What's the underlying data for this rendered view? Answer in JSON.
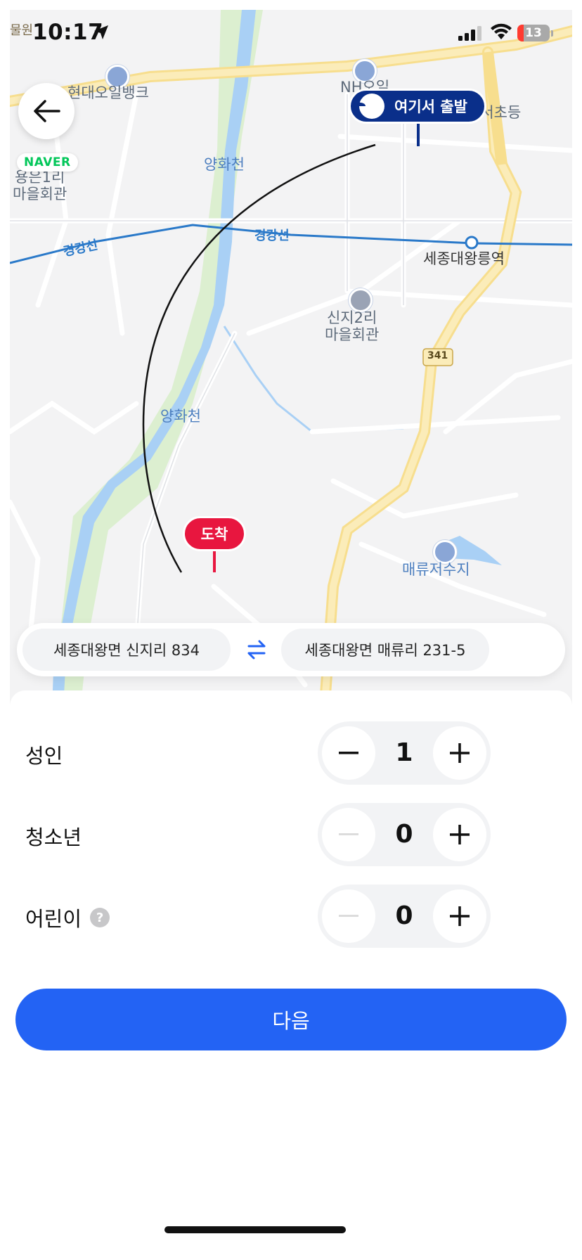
{
  "status_bar": {
    "time": "10:17",
    "battery": "13"
  },
  "map": {
    "provider_logo": "NAVER",
    "start_marker_label": "여기서 출발",
    "arrival_marker_label": "도착",
    "labels": {
      "gas_station": "현대오일뱅크",
      "nh_oil": "NH오일",
      "school": "능서초등",
      "village_hall_1": "용은1리\n마을회관",
      "river_1": "양화천",
      "river_2": "양화천",
      "rail_1": "경강선",
      "rail_2": "경강선",
      "station": "세종대왕릉역",
      "village_hall_2": "신지2리\n마을회관",
      "route_number": "341",
      "reservoir": "매류저수지",
      "corner": "물원"
    }
  },
  "route": {
    "from": "세종대왕면 신지리 834",
    "to": "세종대왕면 매류리 231-5"
  },
  "passengers": [
    {
      "label": "성인",
      "count": "1",
      "minus_enabled": true
    },
    {
      "label": "청소년",
      "count": "0",
      "minus_enabled": false
    },
    {
      "label": "어린이",
      "count": "0",
      "minus_enabled": false
    }
  ],
  "help_icon_glyph": "?",
  "next_button_label": "다음",
  "colors": {
    "primary": "#2363f4",
    "start_marker": "#0a2f8a",
    "arrival_marker": "#e8163f",
    "naver_green": "#03c75a",
    "river": "#a9d0f5",
    "park": "#dcefd0",
    "road_major": "#f7de8e"
  },
  "icons": {
    "back": "arrow-left-icon",
    "swap": "swap-arrows-icon",
    "minus": "minus-icon",
    "plus": "plus-icon",
    "help": "question-circle-icon",
    "user": "user-icon"
  }
}
